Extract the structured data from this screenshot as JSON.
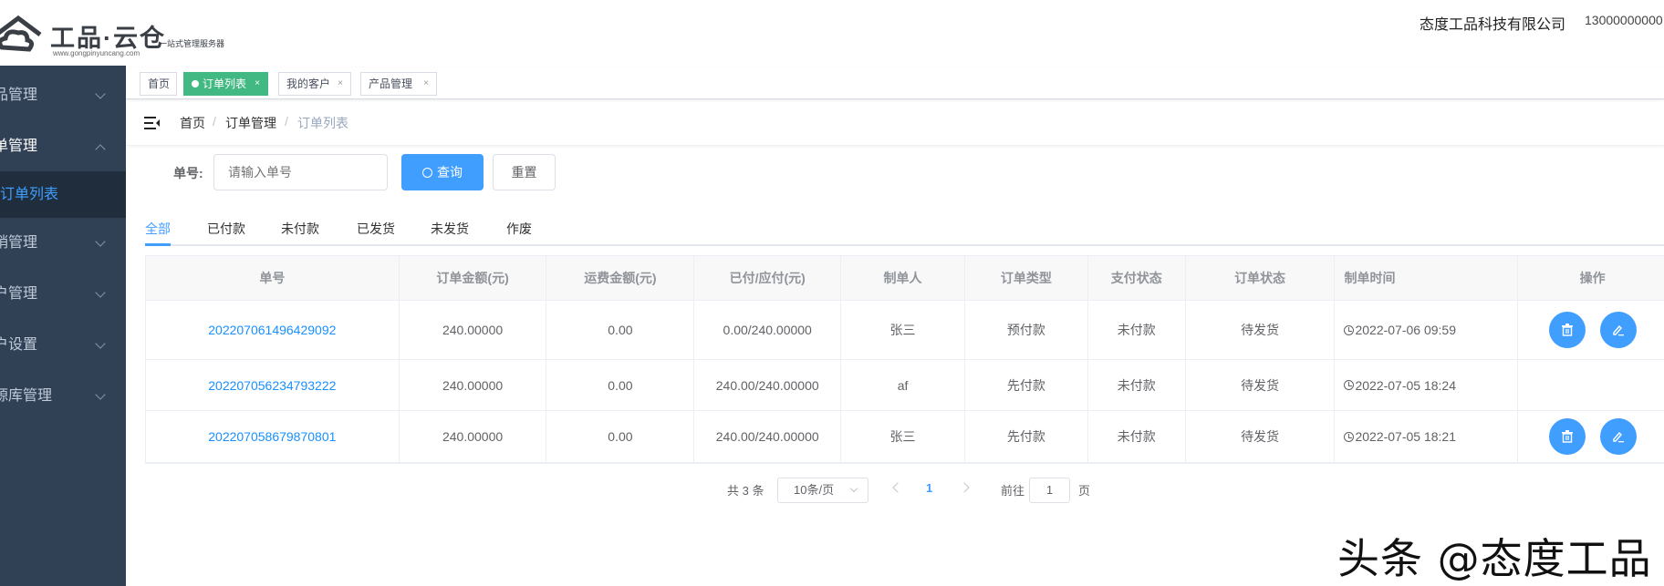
{
  "header": {
    "logo_text": "工品·云仓",
    "logo_slogan": "一站式管理服务器",
    "logo_url": "www.gongpinyuncang.com",
    "company": "态度工品科技有限公司",
    "phone": "13000000000"
  },
  "sidebar": {
    "items": [
      {
        "label": "品管理",
        "state": "collapsed"
      },
      {
        "label": "单管理",
        "state": "expanded"
      },
      {
        "label": "订单列表",
        "state": "active"
      },
      {
        "label": "销管理",
        "state": "collapsed"
      },
      {
        "label": "户管理",
        "state": "collapsed"
      },
      {
        "label": "户设置",
        "state": "collapsed"
      },
      {
        "label": "源库管理",
        "state": "collapsed"
      }
    ],
    "colors": {
      "bg": "#304156",
      "active_bg": "#1f2d3d",
      "active_text": "#409EFF"
    }
  },
  "tags": [
    {
      "label": "首页"
    },
    {
      "label": "订单列表",
      "active": true
    },
    {
      "label": "我的客户"
    },
    {
      "label": "产品管理"
    }
  ],
  "tag_close": "×",
  "breadcrumb": [
    "首页",
    "订单管理",
    "订单列表"
  ],
  "breadcrumb_sep": "/",
  "search": {
    "label": "单号:",
    "placeholder": "请输入单号",
    "query": "查询",
    "reset": "重置"
  },
  "status_tabs": [
    "全部",
    "已付款",
    "未付款",
    "已发货",
    "未发货",
    "作废"
  ],
  "table": {
    "columns": [
      "单号",
      "订单金额(元)",
      "运费金额(元)",
      "已付/应付(元)",
      "制单人",
      "订单类型",
      "支付状态",
      "订单状态",
      "制单时间",
      "操作"
    ],
    "rows": [
      {
        "id": "202207061496429092",
        "amount": "240.00000",
        "freight": "0.00",
        "paid": "0.00/240.00000",
        "creator": "张三",
        "type": "预付款",
        "pay": "未付款",
        "status": "待发货",
        "time": "2022-07-06 09:59",
        "actions": true
      },
      {
        "id": "202207056234793222",
        "amount": "240.00000",
        "freight": "0.00",
        "paid": "240.00/240.00000",
        "creator": "af",
        "type": "先付款",
        "pay": "未付款",
        "status": "待发货",
        "time": "2022-07-05 18:24",
        "actions": false
      },
      {
        "id": "202207058679870801",
        "amount": "240.00000",
        "freight": "0.00",
        "paid": "240.00/240.00000",
        "creator": "张三",
        "type": "先付款",
        "pay": "未付款",
        "status": "待发货",
        "time": "2022-07-05 18:21",
        "actions": true
      }
    ]
  },
  "pagination": {
    "total": "共 3 条",
    "page_size": "10条/页",
    "current": "1",
    "goto_label": "前往",
    "goto_value": "1",
    "page_unit": "页"
  },
  "watermark": "头条 @态度工品",
  "colors": {
    "primary": "#409eff",
    "tag_active": "#42b983",
    "link": "#1890ff"
  }
}
